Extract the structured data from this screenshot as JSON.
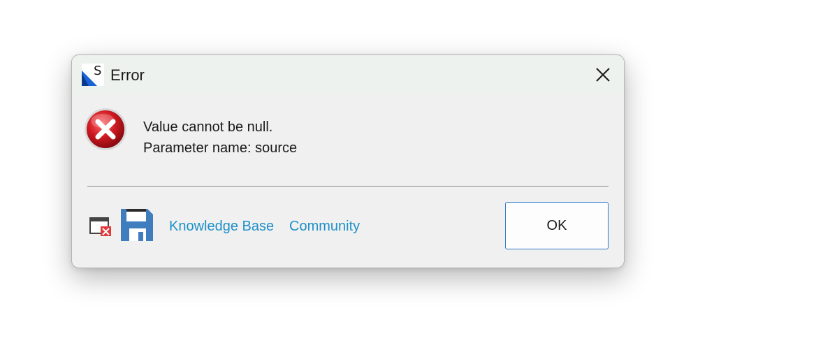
{
  "dialog": {
    "title": "Error",
    "app_icon_letter": "S",
    "close_icon": "close-icon"
  },
  "message": {
    "line1": "Value cannot be null.",
    "line2": "Parameter name: source"
  },
  "footer": {
    "link_knowledge_base": "Knowledge Base",
    "link_community": "Community",
    "ok_label": "OK"
  },
  "colors": {
    "link": "#1e90c8",
    "ok_border": "#2f76c8",
    "error_red": "#c0111b",
    "save_blue": "#3f7dbf"
  }
}
